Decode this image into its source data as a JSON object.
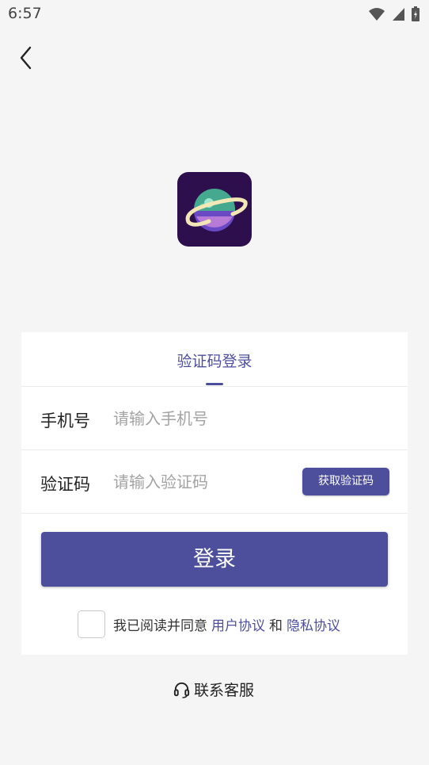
{
  "status_bar": {
    "time": "6:57",
    "icons": [
      "wifi-icon",
      "signal-icon",
      "battery-charging-icon"
    ]
  },
  "nav": {
    "back_icon": "chevron-left-icon"
  },
  "logo": {
    "icon": "planet-app-icon"
  },
  "tabs": [
    {
      "label": "验证码登录",
      "active": true
    }
  ],
  "form": {
    "phone": {
      "label": "手机号",
      "placeholder": "请输入手机号",
      "value": ""
    },
    "code": {
      "label": "验证码",
      "placeholder": "请输入验证码",
      "value": "",
      "button_label": "获取验证码"
    },
    "login_label": "登录",
    "agreement": {
      "checked": false,
      "prefix": "我已阅读并同意",
      "user_agreement": "用户协议",
      "and": "和",
      "privacy": "隐私协议"
    }
  },
  "support": {
    "label": "联系客服",
    "icon": "headset-icon"
  },
  "colors": {
    "accent": "#4d4f9c",
    "background": "#f5f5f5",
    "logo_bg": "#2d0f4e"
  }
}
